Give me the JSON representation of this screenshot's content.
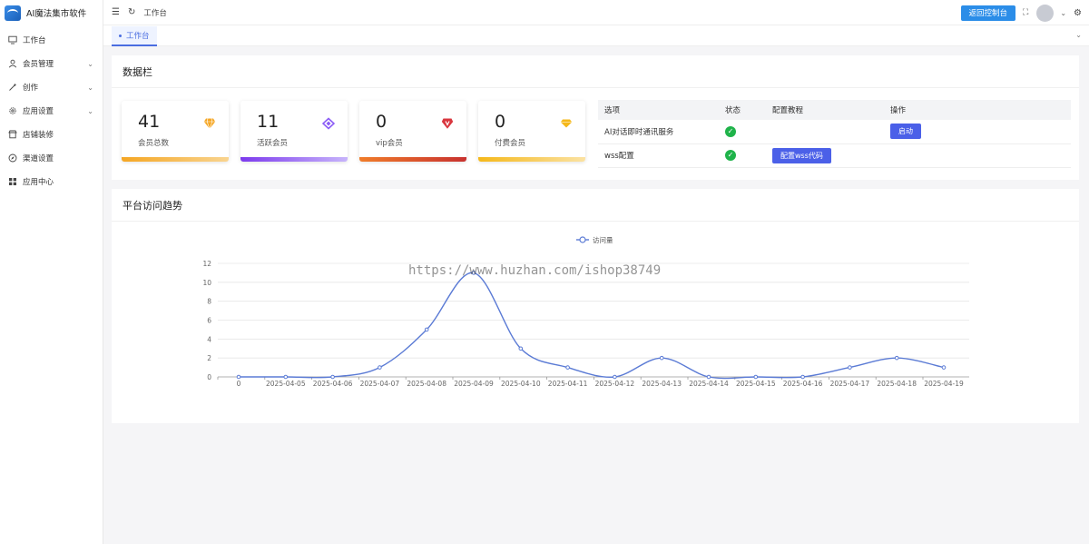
{
  "app": {
    "title": "AI魔法集市软件"
  },
  "sidebar": {
    "items": [
      {
        "label": "工作台",
        "icon": "monitor-icon",
        "has_children": false
      },
      {
        "label": "会员管理",
        "icon": "user-icon",
        "has_children": true
      },
      {
        "label": "创作",
        "icon": "magic-icon",
        "has_children": true
      },
      {
        "label": "应用设置",
        "icon": "gear-icon",
        "has_children": true
      },
      {
        "label": "店铺装修",
        "icon": "shop-icon",
        "has_children": false
      },
      {
        "label": "渠道设置",
        "icon": "compass-icon",
        "has_children": false
      },
      {
        "label": "应用中心",
        "icon": "grid-icon",
        "has_children": false
      }
    ]
  },
  "topbar": {
    "breadcrumb": "工作台",
    "return_button": "返回控制台"
  },
  "tabs": [
    {
      "label": "工作台",
      "active": true
    }
  ],
  "data_panel": {
    "title": "数据栏",
    "cards": [
      {
        "value": "41",
        "label": "会员总数",
        "icon": "diamond-orange-icon",
        "color": "#f5a623"
      },
      {
        "value": "11",
        "label": "活跃会员",
        "icon": "diamond-purple-icon",
        "color": "#8b5cf6"
      },
      {
        "value": "0",
        "label": "vip会员",
        "icon": "vip-red-icon",
        "color": "#d9363e"
      },
      {
        "value": "0",
        "label": "付费会员",
        "icon": "diamond-yellow-icon",
        "color": "#f5b81a"
      }
    ],
    "table": {
      "headers": [
        "选项",
        "状态",
        "配置教程",
        "操作"
      ],
      "rows": [
        {
          "option": "AI对话即时通讯服务",
          "status": "ok",
          "tutorial": "",
          "action": "启动"
        },
        {
          "option": "wss配置",
          "status": "ok",
          "tutorial": "配置wss代码",
          "action": ""
        }
      ]
    }
  },
  "trend_panel": {
    "title": "平台访问趋势"
  },
  "watermark": "https://www.huzhan.com/ishop38749",
  "chart_data": {
    "type": "line",
    "categories": [
      "0",
      "2025-04-05",
      "2025-04-06",
      "2025-04-07",
      "2025-04-08",
      "2025-04-09",
      "2025-04-10",
      "2025-04-11",
      "2025-04-12",
      "2025-04-13",
      "2025-04-14",
      "2025-04-15",
      "2025-04-16",
      "2025-04-17",
      "2025-04-18",
      "2025-04-19"
    ],
    "series": [
      {
        "name": "访问量",
        "values": [
          0,
          0,
          0,
          1,
          5,
          11,
          3,
          1,
          0,
          2,
          0,
          0,
          0,
          1,
          2,
          1
        ],
        "color": "#5b7bd5"
      }
    ],
    "ylim": [
      0,
      12
    ],
    "yticks": [
      0,
      2,
      4,
      6,
      8,
      10,
      12
    ],
    "smooth": true,
    "grid": true,
    "legend": "top-center"
  }
}
